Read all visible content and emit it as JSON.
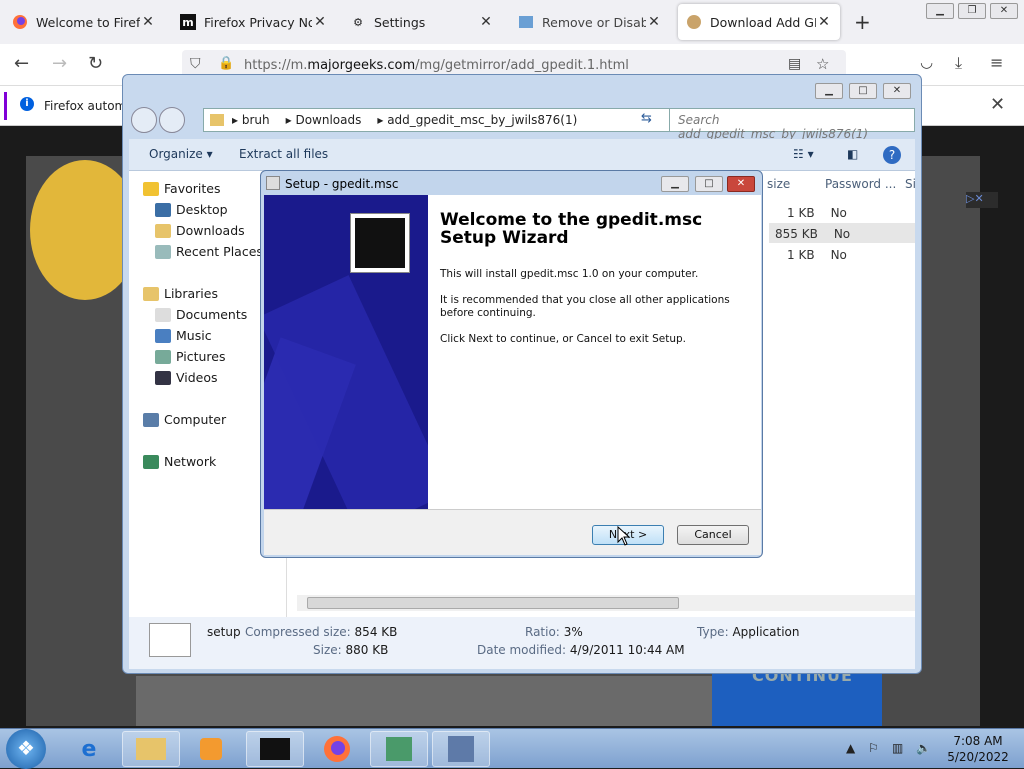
{
  "browser": {
    "tabs": [
      {
        "title": "Welcome to Firefox",
        "active": false,
        "icon": "firefox-icon"
      },
      {
        "title": "Firefox Privacy Notice",
        "active": false,
        "icon": "majorgeeks-m-icon"
      },
      {
        "title": "Settings",
        "active": false,
        "icon": "gear-icon"
      },
      {
        "title": "Remove or Disable Sl",
        "active": false,
        "icon": "page-icon"
      },
      {
        "title": "Download Add GPEDI",
        "active": true,
        "icon": "page-icon"
      }
    ],
    "url_prefix": "https://m.",
    "url_domain": "majorgeeks.com",
    "url_path": "/mg/getmirror/add_gpedit.1.html",
    "notification": "Firefox automa",
    "page_footer_text": "CONTINUE"
  },
  "explorer": {
    "breadcrumbs": [
      "bruh",
      "Downloads",
      "add_gpedit_msc_by_jwils876(1)"
    ],
    "search_placeholder": "Search add_gpedit_msc_by_jwils876(1)",
    "toolbar": {
      "organize": "Organize ▾",
      "extract": "Extract all files"
    },
    "nav": {
      "favorites": "Favorites",
      "favorites_items": [
        "Desktop",
        "Downloads",
        "Recent Places"
      ],
      "libraries": "Libraries",
      "libraries_items": [
        "Documents",
        "Music",
        "Pictures",
        "Videos"
      ],
      "computer": "Computer",
      "network": "Network"
    },
    "columns": [
      "size",
      "Password ...",
      "Si"
    ],
    "rows": [
      {
        "size": "1 KB",
        "password": "No"
      },
      {
        "size": "855 KB",
        "password": "No"
      },
      {
        "size": "1 KB",
        "password": "No"
      }
    ],
    "status": {
      "name": "setup",
      "compressed_label": "Compressed size:",
      "compressed_value": "854 KB",
      "size_label": "Size:",
      "size_value": "880 KB",
      "ratio_label": "Ratio:",
      "ratio_value": "3%",
      "modified_label": "Date modified:",
      "modified_value": "4/9/2011 10:44 AM",
      "type_label": "Type:",
      "type_value": "Application"
    }
  },
  "setup": {
    "title": "Setup - gpedit.msc",
    "heading": "Welcome to the gpedit.msc Setup Wizard",
    "line1": "This will install gpedit.msc 1.0 on your computer.",
    "line2": "It is recommended that you close all other applications before continuing.",
    "line3": "Click Next to continue, or Cancel to exit Setup.",
    "next": "Next >",
    "cancel": "Cancel"
  },
  "taskbar": {
    "time": "7:08 AM",
    "date": "5/20/2022"
  },
  "colors": {
    "accent": "#0060df",
    "banner": "#1a1a8c",
    "taskbar": "#8fb0d9"
  }
}
